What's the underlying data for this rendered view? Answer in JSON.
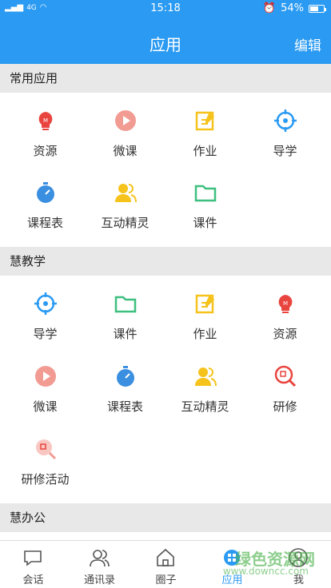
{
  "status": {
    "signal": "4G",
    "time": "15:18",
    "battery": "54%"
  },
  "header": {
    "title": "应用",
    "edit_label": "编辑"
  },
  "sections": [
    {
      "title": "常用应用",
      "items": [
        {
          "label": "资源",
          "icon": "bulb-icon"
        },
        {
          "label": "微课",
          "icon": "play-icon"
        },
        {
          "label": "作业",
          "icon": "edit-icon"
        },
        {
          "label": "导学",
          "icon": "target-icon"
        },
        {
          "label": "课程表",
          "icon": "stopwatch-icon"
        },
        {
          "label": "互动精灵",
          "icon": "users-icon"
        },
        {
          "label": "课件",
          "icon": "folder-icon"
        }
      ]
    },
    {
      "title": "慧教学",
      "items": [
        {
          "label": "导学",
          "icon": "target-icon"
        },
        {
          "label": "课件",
          "icon": "folder-icon"
        },
        {
          "label": "作业",
          "icon": "edit-icon"
        },
        {
          "label": "资源",
          "icon": "bulb-icon"
        },
        {
          "label": "微课",
          "icon": "play-icon"
        },
        {
          "label": "课程表",
          "icon": "stopwatch-icon"
        },
        {
          "label": "互动精灵",
          "icon": "users-icon"
        },
        {
          "label": "研修",
          "icon": "search-doc-icon"
        },
        {
          "label": "研修活动",
          "icon": "search-doc-icon"
        }
      ]
    },
    {
      "title": "慧办公",
      "items": []
    }
  ],
  "tabs": [
    {
      "label": "会话",
      "icon": "chat-icon"
    },
    {
      "label": "通讯录",
      "icon": "contacts-icon"
    },
    {
      "label": "圈子",
      "icon": "home-icon"
    },
    {
      "label": "应用",
      "icon": "apps-icon"
    },
    {
      "label": "我",
      "icon": "person-icon"
    }
  ],
  "watermark": {
    "text": "绿色资源网",
    "url": "www.downcc.com"
  },
  "colors": {
    "primary": "#2a9af2",
    "red": "#e9453f",
    "pink": "#f29b93",
    "yellow": "#f5c31c",
    "green": "#3dbf7f",
    "blue": "#3b8fe0"
  }
}
